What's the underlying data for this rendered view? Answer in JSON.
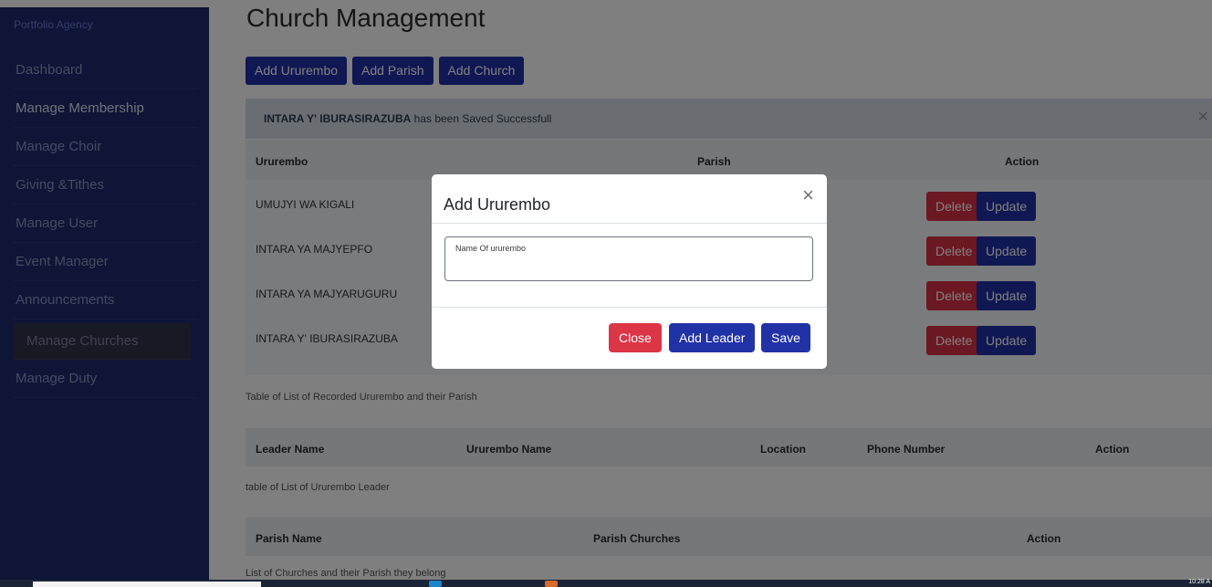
{
  "sidebar": {
    "brand": "Portfolio Agency",
    "items": [
      {
        "label": "Dashboard"
      },
      {
        "label": "Manage Membership"
      },
      {
        "label": "Manage Choir"
      },
      {
        "label": "Giving &Tithes"
      },
      {
        "label": "Manage User"
      },
      {
        "label": "Event Manager"
      },
      {
        "label": "Announcements"
      },
      {
        "label": "Manage Churches"
      },
      {
        "label": "Manage Duty"
      }
    ]
  },
  "page_title": "Church Management",
  "actions": {
    "add_urrurembo": "Add Ururembo",
    "add_parish": "Add Parish",
    "add_church": "Add Church"
  },
  "alert": {
    "bold": "INTARA Y' IBURASIRAZUBA",
    "rest": " has been Saved Successfull",
    "close_icon": "×"
  },
  "ururembo_table": {
    "headers": {
      "ururembo": "Ururembo",
      "parish": "Parish",
      "action": "Action"
    },
    "rows": [
      {
        "name": "UMUJYI WA KIGALI"
      },
      {
        "name": "INTARA YA MAJYEPFO"
      },
      {
        "name": "INTARA YA MAJYARUGURU"
      },
      {
        "name": "INTARA Y' IBURASIRAZUBA"
      }
    ],
    "delete_label": "Delete",
    "update_label": "Update",
    "caption": "Table of List of Recorded Ururembo and their Parish"
  },
  "leader_table": {
    "headers": {
      "leader_name": "Leader Name",
      "ururembo_name": "Ururembo Name",
      "location": "Location",
      "phone": "Phone Number",
      "action": "Action"
    },
    "caption": "table of List of Ururembo Leader"
  },
  "parish_table": {
    "headers": {
      "parish_name": "Parish Name",
      "parish_churches": "Parish Churches",
      "action": "Action"
    },
    "caption": "List of Churches and their Parish they belong"
  },
  "modal": {
    "title": "Add Ururembo",
    "close_icon": "×",
    "field_label": "Name Of ururembo",
    "field_value": "",
    "close_label": "Close",
    "add_leader_label": "Add Leader",
    "save_label": "Save"
  },
  "taskbar": {
    "time": "10:28 A"
  },
  "colors": {
    "sidebar": "#1e2b6c",
    "primary": "#2131a6",
    "danger": "#dc3545"
  }
}
